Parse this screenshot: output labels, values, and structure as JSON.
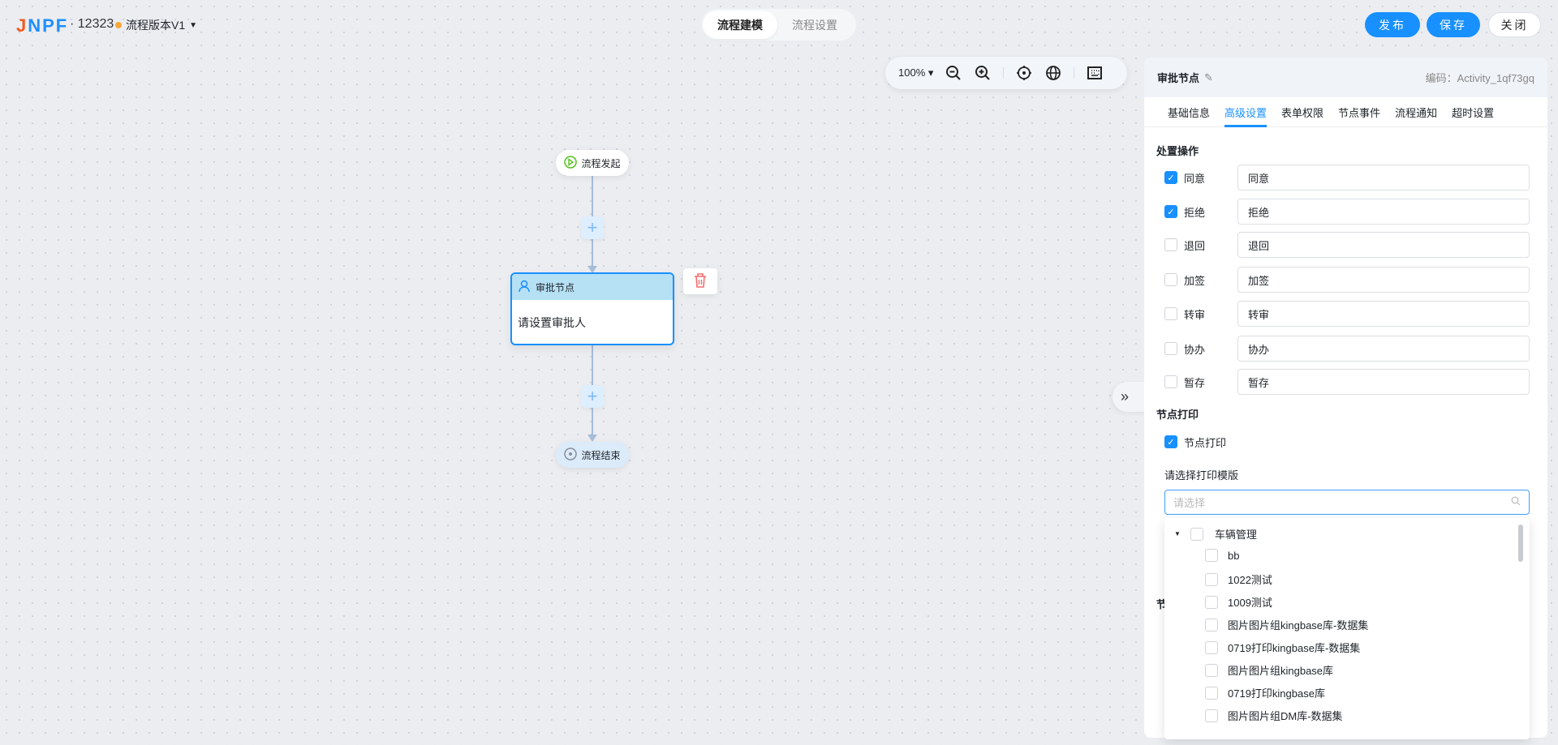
{
  "header": {
    "logo": "JNPF",
    "project": "· 12323",
    "version": "流程版本V1",
    "mode_tabs": [
      "流程建模",
      "流程设置"
    ],
    "active_mode": 0,
    "buttons": {
      "publish": "发布",
      "save": "保存",
      "close": "关闭"
    }
  },
  "toolbar": {
    "zoom": "100%",
    "icons": [
      "zoom-out-icon",
      "zoom-in-icon",
      "locate-icon",
      "globe-icon",
      "minimap-icon"
    ]
  },
  "canvas": {
    "start": "流程发起",
    "approver": {
      "title": "审批节点",
      "body": "请设置审批人"
    },
    "end": "流程结束"
  },
  "panel": {
    "title": "审批节点",
    "code": "编码：Activity_1qf73gq",
    "tabs": [
      "基础信息",
      "高级设置",
      "表单权限",
      "节点事件",
      "流程通知",
      "超时设置"
    ],
    "active_tab": 1,
    "ops_title": "处置操作",
    "ops": [
      {
        "label": "同意",
        "value": "同意",
        "checked": true
      },
      {
        "label": "拒绝",
        "value": "拒绝",
        "checked": true
      },
      {
        "label": "退回",
        "value": "退回",
        "checked": false
      },
      {
        "label": "加签",
        "value": "加签",
        "checked": false
      },
      {
        "label": "转审",
        "value": "转审",
        "checked": false
      },
      {
        "label": "协办",
        "value": "协办",
        "checked": false
      },
      {
        "label": "暂存",
        "value": "暂存",
        "checked": false
      }
    ],
    "print_title": "节点打印",
    "print_checkbox": "节点打印",
    "print_template_label": "请选择打印模版",
    "select_placeholder": "请选择",
    "hidden_heading": "节",
    "tree": {
      "group": "车辆管理",
      "items": [
        "bb",
        "1022测试",
        "1009测试",
        "图片图片组kingbase库-数据集",
        "0719打印kingbase库-数据集",
        "图片图片组kingbase库",
        "0719打印kingbase库",
        "图片图片组DM库-数据集"
      ]
    }
  },
  "colors": {
    "accent": "#1890ff",
    "node_header": "#b6e0f4",
    "connector": "#a6bcd8"
  }
}
